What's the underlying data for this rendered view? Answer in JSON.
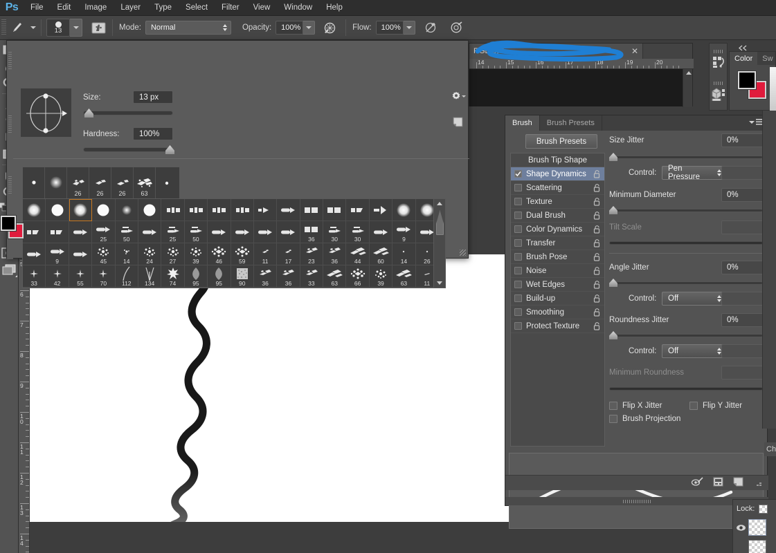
{
  "app": {
    "logo": "Ps",
    "name": "Adobe Photoshop"
  },
  "menubar": {
    "items": [
      "File",
      "Edit",
      "Image",
      "Layer",
      "Type",
      "Select",
      "Filter",
      "View",
      "Window",
      "Help"
    ]
  },
  "options_bar": {
    "tool_icon": "paintbrush-icon",
    "brush_size_display": "13",
    "brush_folder_icon": "brush-panel-toggle-icon",
    "mode_label": "Mode:",
    "mode_value": "Normal",
    "opacity_label": "Opacity:",
    "opacity_value": "100%",
    "opacity_pressure_icon": "pressure-opacity-icon",
    "flow_label": "Flow:",
    "flow_value": "100%",
    "airbrush_icon": "airbrush-icon",
    "smoothing_icon": "tablet-pressure-size-icon"
  },
  "toolbar": {
    "tools": [
      {
        "name": "gradient-tool",
        "has_flyout": true
      },
      {
        "name": "blur-tool",
        "has_flyout": true
      },
      {
        "name": "dodge-tool",
        "has_flyout": true
      },
      {
        "name": "pen-tool",
        "has_flyout": true
      },
      {
        "name": "type-tool",
        "has_flyout": true
      },
      {
        "name": "path-selection-tool",
        "has_flyout": true
      },
      {
        "name": "rectangle-shape-tool",
        "has_flyout": true
      },
      {
        "name": "hand-tool",
        "has_flyout": true
      },
      {
        "name": "zoom-tool",
        "has_flyout": false
      }
    ],
    "foreground_color": "#000000",
    "background_color": "#e01b3c",
    "quick_mask_icon": "quick-mask-icon",
    "screen_mode_icon": "screen-mode-icon",
    "swap_colors_icon": "swap-colors-icon",
    "default_colors_icon": "default-colors-icon"
  },
  "vertical_ruler": {
    "labels": [
      "5",
      "6",
      "7",
      "8",
      "9",
      "10",
      "11",
      "12",
      "13",
      "14"
    ]
  },
  "document": {
    "tab_title": "RGB/8) *",
    "tab_title_obscured": true,
    "close_icon": "close-icon",
    "horizontal_ruler_labels": [
      "14",
      "15",
      "16",
      "17",
      "18",
      "19",
      "20"
    ],
    "annotation": "blue-scribble-redaction"
  },
  "brush_picker": {
    "size_label": "Size:",
    "size_value": "13 px",
    "size_slider_pct": 4,
    "hardness_label": "Hardness:",
    "hardness_value": "100%",
    "hardness_slider_pct": 100,
    "tip_angle_icon": "brush-tip-angle-roundness-control",
    "gear_icon": "settings-gear-icon",
    "new_preset_icon": "new-brush-preset-icon",
    "recent_brushes": [
      {
        "icon": "soft-round-small",
        "label": ""
      },
      {
        "icon": "soft-round",
        "label": ""
      },
      {
        "icon": "chalk-scatter",
        "label": "26"
      },
      {
        "icon": "chalk-scatter",
        "label": "26"
      },
      {
        "icon": "chalk-scatter",
        "label": "26"
      },
      {
        "icon": "scatter-dense",
        "label": "63"
      },
      {
        "icon": "hard-round-tiny",
        "label": ""
      }
    ],
    "grid_rows": [
      [
        {
          "icon": "soft-round",
          "label": ""
        },
        {
          "icon": "hard-round",
          "label": ""
        },
        {
          "icon": "soft-round",
          "label": "",
          "selected": true
        },
        {
          "icon": "hard-round",
          "label": ""
        },
        {
          "icon": "soft-round-small",
          "label": ""
        },
        {
          "icon": "hard-round",
          "label": ""
        },
        {
          "icon": "flat-tip",
          "label": ""
        },
        {
          "icon": "flat-tip",
          "label": ""
        },
        {
          "icon": "flat-tip",
          "label": ""
        },
        {
          "icon": "flat-tip",
          "label": ""
        },
        {
          "icon": "fan-tip",
          "label": ""
        },
        {
          "icon": "round-point",
          "label": ""
        },
        {
          "icon": "flat-block",
          "label": ""
        },
        {
          "icon": "flat-block",
          "label": ""
        },
        {
          "icon": "angled-flat",
          "label": ""
        },
        {
          "icon": "fan-wide",
          "label": ""
        },
        {
          "icon": "soft-round",
          "label": ""
        },
        {
          "icon": "soft-round",
          "label": ""
        }
      ],
      [
        {
          "icon": "angled-flat",
          "label": ""
        },
        {
          "icon": "angled-flat",
          "label": ""
        },
        {
          "icon": "round-point",
          "label": ""
        },
        {
          "icon": "round-point",
          "label": "25"
        },
        {
          "icon": "flat-fan",
          "label": "50"
        },
        {
          "icon": "round-point",
          "label": ""
        },
        {
          "icon": "flat-fan",
          "label": "25"
        },
        {
          "icon": "flat-fan",
          "label": "50"
        },
        {
          "icon": "round-point",
          "label": ""
        },
        {
          "icon": "round-point",
          "label": ""
        },
        {
          "icon": "round-point",
          "label": ""
        },
        {
          "icon": "round-point",
          "label": ""
        },
        {
          "icon": "flat-block",
          "label": "36"
        },
        {
          "icon": "flat-fan",
          "label": "30"
        },
        {
          "icon": "flat-fan",
          "label": "30"
        },
        {
          "icon": "round-point",
          "label": ""
        },
        {
          "icon": "round-point",
          "label": "9"
        },
        {
          "icon": "round-point",
          "label": ""
        }
      ],
      [
        {
          "icon": "round-point",
          "label": ""
        },
        {
          "icon": "round-point",
          "label": "9"
        },
        {
          "icon": "round-point",
          "label": ""
        },
        {
          "icon": "spatter",
          "label": "45"
        },
        {
          "icon": "spatter-small",
          "label": "14"
        },
        {
          "icon": "spatter",
          "label": "24"
        },
        {
          "icon": "spatter",
          "label": "27"
        },
        {
          "icon": "spatter",
          "label": "39"
        },
        {
          "icon": "spatter-dense",
          "label": "46"
        },
        {
          "icon": "spatter-dense",
          "label": "59"
        },
        {
          "icon": "chalk-tiny",
          "label": "11"
        },
        {
          "icon": "chalk-tiny",
          "label": "17"
        },
        {
          "icon": "chalk",
          "label": "23"
        },
        {
          "icon": "chalk",
          "label": "36"
        },
        {
          "icon": "chalk-wide",
          "label": "44"
        },
        {
          "icon": "chalk-wide",
          "label": "60"
        },
        {
          "icon": "dot-tiny",
          "label": "14"
        },
        {
          "icon": "dot-tiny",
          "label": "26"
        }
      ],
      [
        {
          "icon": "star-small",
          "label": "33"
        },
        {
          "icon": "star-small",
          "label": "42"
        },
        {
          "icon": "star-small",
          "label": "55"
        },
        {
          "icon": "star-small",
          "label": "70"
        },
        {
          "icon": "grass-blade",
          "label": "112"
        },
        {
          "icon": "grass-tuft",
          "label": "134"
        },
        {
          "icon": "maple-leaf",
          "label": "74"
        },
        {
          "icon": "leaf",
          "label": "95"
        },
        {
          "icon": "leaf",
          "label": "95"
        },
        {
          "icon": "texture-block",
          "label": "90"
        },
        {
          "icon": "chalk",
          "label": "36"
        },
        {
          "icon": "chalk",
          "label": "36"
        },
        {
          "icon": "chalk",
          "label": "33"
        },
        {
          "icon": "chalk-wide",
          "label": "63"
        },
        {
          "icon": "spatter-dense",
          "label": "66"
        },
        {
          "icon": "spatter",
          "label": "39"
        },
        {
          "icon": "chalk-wide",
          "label": "63"
        },
        {
          "icon": "dash-tiny",
          "label": "11"
        }
      ]
    ]
  },
  "brush_panel": {
    "tabs": [
      {
        "label": "Brush",
        "active": true
      },
      {
        "label": "Brush Presets",
        "active": false
      }
    ],
    "panel_menu_icon": "panel-menu-icon",
    "presets_button": "Brush Presets",
    "list_header": "Brush Tip Shape",
    "list_items": [
      {
        "label": "Shape Dynamics",
        "checked": true,
        "selected": true,
        "lock": "unlocked-icon"
      },
      {
        "label": "Scattering",
        "checked": false,
        "selected": false,
        "lock": "unlocked-icon"
      },
      {
        "label": "Texture",
        "checked": false,
        "selected": false,
        "lock": "unlocked-icon"
      },
      {
        "label": "Dual Brush",
        "checked": false,
        "selected": false,
        "lock": "unlocked-icon"
      },
      {
        "label": "Color Dynamics",
        "checked": false,
        "selected": false,
        "lock": "unlocked-icon"
      },
      {
        "label": "Transfer",
        "checked": false,
        "selected": false,
        "lock": "unlocked-icon"
      },
      {
        "label": "Brush Pose",
        "checked": false,
        "selected": false,
        "lock": "unlocked-icon"
      },
      {
        "label": "Noise",
        "checked": false,
        "selected": false,
        "lock": "unlocked-icon"
      },
      {
        "label": "Wet Edges",
        "checked": false,
        "selected": false,
        "lock": "unlocked-icon"
      },
      {
        "label": "Build-up",
        "checked": false,
        "selected": false,
        "lock": "unlocked-icon"
      },
      {
        "label": "Smoothing",
        "checked": false,
        "selected": false,
        "lock": "unlocked-icon"
      },
      {
        "label": "Protect Texture",
        "checked": false,
        "selected": false,
        "lock": "unlocked-icon"
      }
    ],
    "size_jitter": {
      "label": "Size Jitter",
      "value": "0%",
      "slider_pct": 0
    },
    "size_control": {
      "label": "Control:",
      "value": "Pen Pressure"
    },
    "minimum_diameter": {
      "label": "Minimum Diameter",
      "value": "0%",
      "slider_pct": 0
    },
    "tilt_scale": {
      "label": "Tilt Scale",
      "value": "",
      "disabled": true
    },
    "angle_jitter": {
      "label": "Angle Jitter",
      "value": "0%",
      "slider_pct": 0
    },
    "angle_control": {
      "label": "Control:",
      "value": "Off"
    },
    "roundness_jitter": {
      "label": "Roundness Jitter",
      "value": "0%",
      "slider_pct": 0
    },
    "roundness_control": {
      "label": "Control:",
      "value": "Off"
    },
    "minimum_roundness": {
      "label": "Minimum Roundness",
      "value": "",
      "disabled": true
    },
    "flip_x_jitter": {
      "label": "Flip X Jitter",
      "checked": false
    },
    "flip_y_jitter": {
      "label": "Flip Y Jitter",
      "checked": false
    },
    "brush_projection": {
      "label": "Brush Projection",
      "checked": false
    },
    "stroke_preview": "tapered-wavy-stroke-preview",
    "footer_icons": [
      "toggle-brush-preview-icon",
      "create-brush-from-preset-icon",
      "new-brush-preset-icon",
      "delete-brush-icon"
    ]
  },
  "right_dock": {
    "collapse_icon": "collapse-panels-icon",
    "icon_panels": [
      "history-panel-icon",
      "properties-3d-panel-icon"
    ],
    "color_panel": {
      "tabs": [
        "Color",
        "Sw"
      ],
      "foreground": "#000000",
      "background": "#e01b3c",
      "close_icon": "close-icon",
      "collapse_icon": "collapse-icon"
    },
    "channels_tab": "Ch",
    "layers_panel": {
      "lock_label": "Lock:",
      "lock_transparent_icon": "lock-transparent-pixels-icon",
      "eye_icon": "layer-visibility-icon",
      "layer_thumbnail": "transparent-checkerboard"
    }
  },
  "canvas": {
    "artwork": "tapered-wavy-brush-stroke",
    "background": "#ffffff"
  }
}
